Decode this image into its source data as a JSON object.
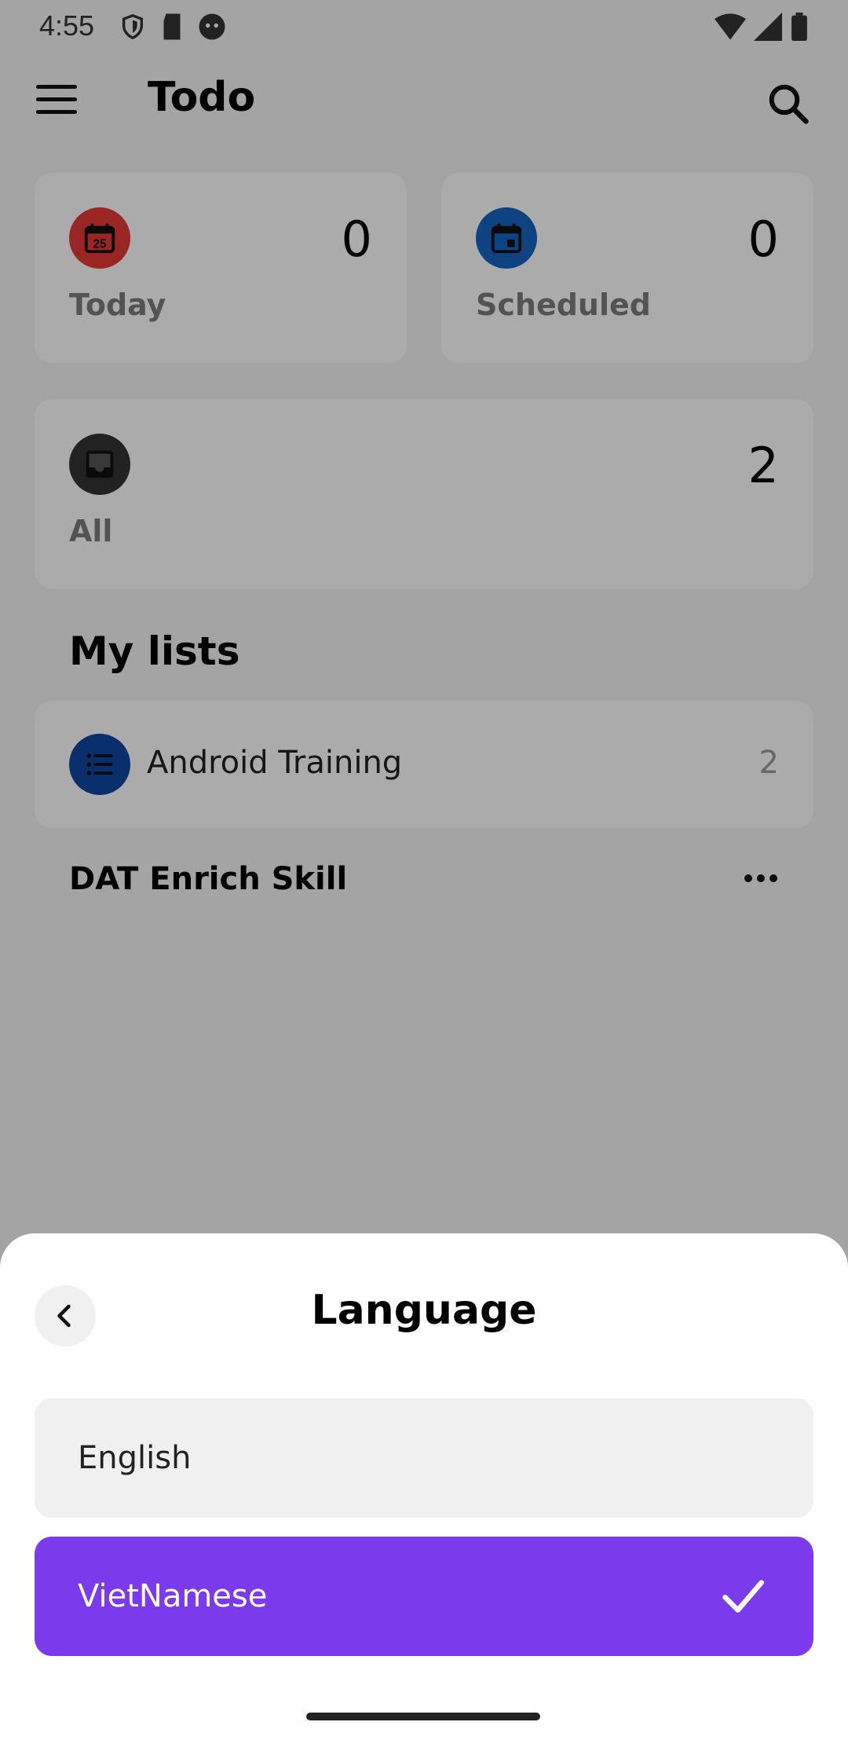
{
  "status": {
    "time": "4:55"
  },
  "app": {
    "title": "Todo"
  },
  "cards": {
    "today": {
      "label": "Today",
      "count": "0",
      "icon_day": "25",
      "color": "#e53935"
    },
    "scheduled": {
      "label": "Scheduled",
      "count": "0",
      "color": "#1565c0"
    },
    "all": {
      "label": "All",
      "count": "2",
      "color": "#333333"
    }
  },
  "my_lists": {
    "title": "My lists",
    "items": [
      {
        "name": "Android Training",
        "count": "2",
        "color": "#0d47a1"
      }
    ]
  },
  "group": {
    "title": "DAT Enrich Skill"
  },
  "sheet": {
    "title": "Language",
    "options": [
      {
        "label": "English",
        "selected": false
      },
      {
        "label": "VietNamese",
        "selected": true
      }
    ],
    "accent": "#7c3aed"
  }
}
